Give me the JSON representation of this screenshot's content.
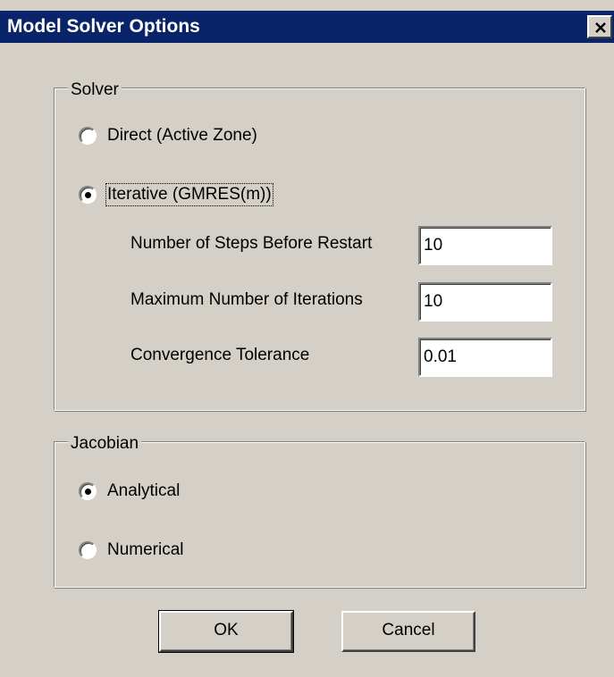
{
  "window": {
    "title": "Model Solver Options",
    "close_icon": "close-icon"
  },
  "solver_group": {
    "label": "Solver",
    "options": [
      {
        "label": "Direct (Active Zone)",
        "selected": false
      },
      {
        "label": "Iterative (GMRES(m))",
        "selected": true
      }
    ],
    "fields": [
      {
        "label": "Number of Steps Before Restart",
        "value": "10"
      },
      {
        "label": "Maximum Number of Iterations",
        "value": "10"
      },
      {
        "label": "Convergence Tolerance",
        "value": "0.01"
      }
    ]
  },
  "jacobian_group": {
    "label": "Jacobian",
    "options": [
      {
        "label": "Analytical",
        "selected": true
      },
      {
        "label": "Numerical",
        "selected": false
      }
    ]
  },
  "buttons": {
    "ok_label": "OK",
    "cancel_label": "Cancel"
  },
  "colors": {
    "face": "#d4d0c8",
    "titlebar": "#0a246a",
    "title_text": "#ffffff"
  }
}
